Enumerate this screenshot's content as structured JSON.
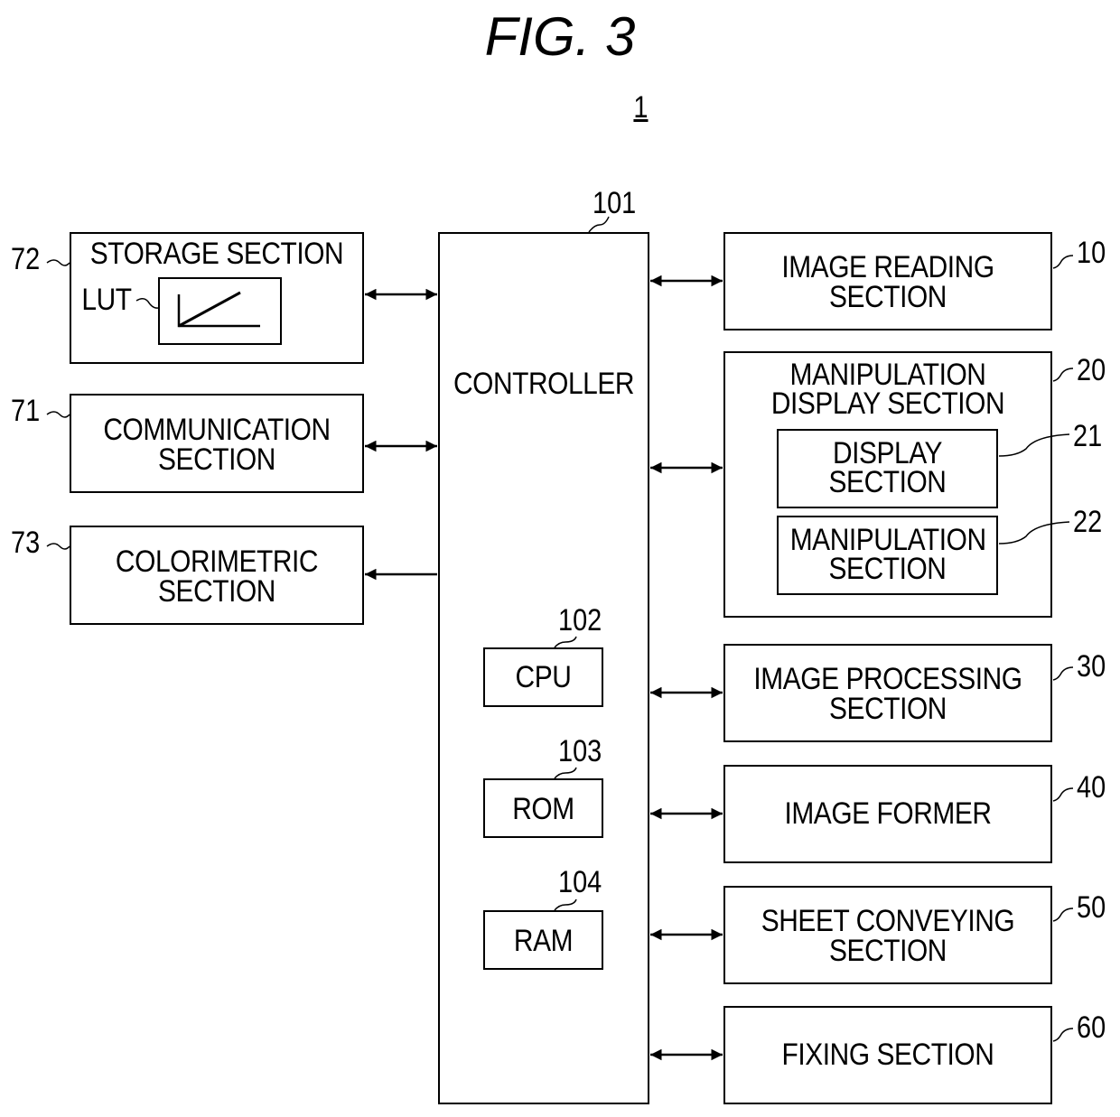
{
  "figure": {
    "title": "FIG. 3",
    "system_ref": "1"
  },
  "controller": {
    "ref": "101",
    "label": "CONTROLLER",
    "cpu": {
      "ref": "102",
      "label": "CPU"
    },
    "rom": {
      "ref": "103",
      "label": "ROM"
    },
    "ram": {
      "ref": "104",
      "label": "RAM"
    }
  },
  "left_blocks": {
    "storage": {
      "ref": "72",
      "label": "STORAGE SECTION",
      "lut_label": "LUT",
      "arrow": "bidirectional"
    },
    "communication": {
      "ref": "71",
      "line1": "COMMUNICATION",
      "line2": "SECTION",
      "arrow": "bidirectional"
    },
    "colorimetric": {
      "ref": "73",
      "line1": "COLORIMETRIC",
      "line2": "SECTION",
      "arrow": "from-controller"
    }
  },
  "right_blocks": {
    "image_reading": {
      "ref": "10",
      "line1": "IMAGE READING",
      "line2": "SECTION",
      "arrow": "bidirectional"
    },
    "manipulation_display": {
      "ref": "20",
      "line1": "MANIPULATION",
      "line2": "DISPLAY SECTION",
      "arrow": "bidirectional",
      "display": {
        "ref": "21",
        "line1": "DISPLAY",
        "line2": "SECTION"
      },
      "manipulation": {
        "ref": "22",
        "line1": "MANIPULATION",
        "line2": "SECTION"
      }
    },
    "image_processing": {
      "ref": "30",
      "line1": "IMAGE PROCESSING",
      "line2": "SECTION",
      "arrow": "bidirectional"
    },
    "image_former": {
      "ref": "40",
      "label": "IMAGE FORMER",
      "arrow": "bidirectional"
    },
    "sheet_conveying": {
      "ref": "50",
      "line1": "SHEET CONVEYING",
      "line2": "SECTION",
      "arrow": "bidirectional"
    },
    "fixing": {
      "ref": "60",
      "label": "FIXING SECTION",
      "arrow": "bidirectional"
    }
  }
}
